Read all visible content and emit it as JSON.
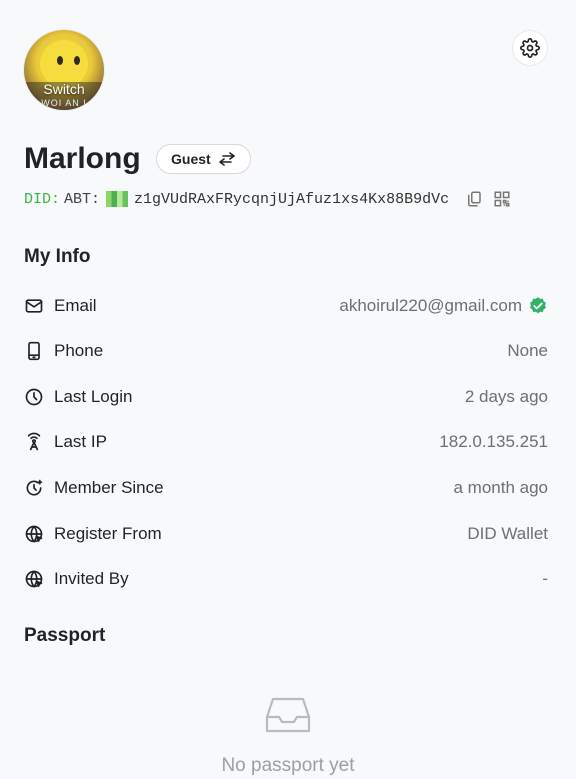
{
  "profile": {
    "avatar_label": "Switch",
    "avatar_sublabel": "WOI AN I",
    "name": "Marlong",
    "role": "Guest",
    "did_prefix": "DID:",
    "did_chain": "ABT:",
    "did_value": "z1gVUdRAxFRycqnjUjAfuz1xs4Kx88B9dVc"
  },
  "icons": {
    "settings": "gear-icon",
    "switch": "swap-arrows-icon",
    "copy": "copy-icon",
    "qr": "qr-code-icon",
    "verified": "verified-check-icon"
  },
  "my_info": {
    "title": "My Info",
    "rows": [
      {
        "label": "Email",
        "value": "akhoirul220@gmail.com",
        "icon": "mail-icon"
      },
      {
        "label": "Phone",
        "value": "None",
        "icon": "phone-icon"
      },
      {
        "label": "Last Login",
        "value": "2 days ago",
        "icon": "clock-icon"
      },
      {
        "label": "Last IP",
        "value": "182.0.135.251",
        "icon": "antenna-icon"
      },
      {
        "label": "Member Since",
        "value": "a month ago",
        "icon": "history-icon"
      },
      {
        "label": "Register From",
        "value": "DID Wallet",
        "icon": "globe-icon"
      },
      {
        "label": "Invited By",
        "value": "-",
        "icon": "globe-icon"
      }
    ]
  },
  "passport": {
    "title": "Passport",
    "empty_text": "No passport yet",
    "empty_icon": "inbox-icon"
  },
  "colors": {
    "accent_green": "#3bb54a",
    "verified_green": "#2fb36b",
    "muted_text": "#6b7075"
  }
}
